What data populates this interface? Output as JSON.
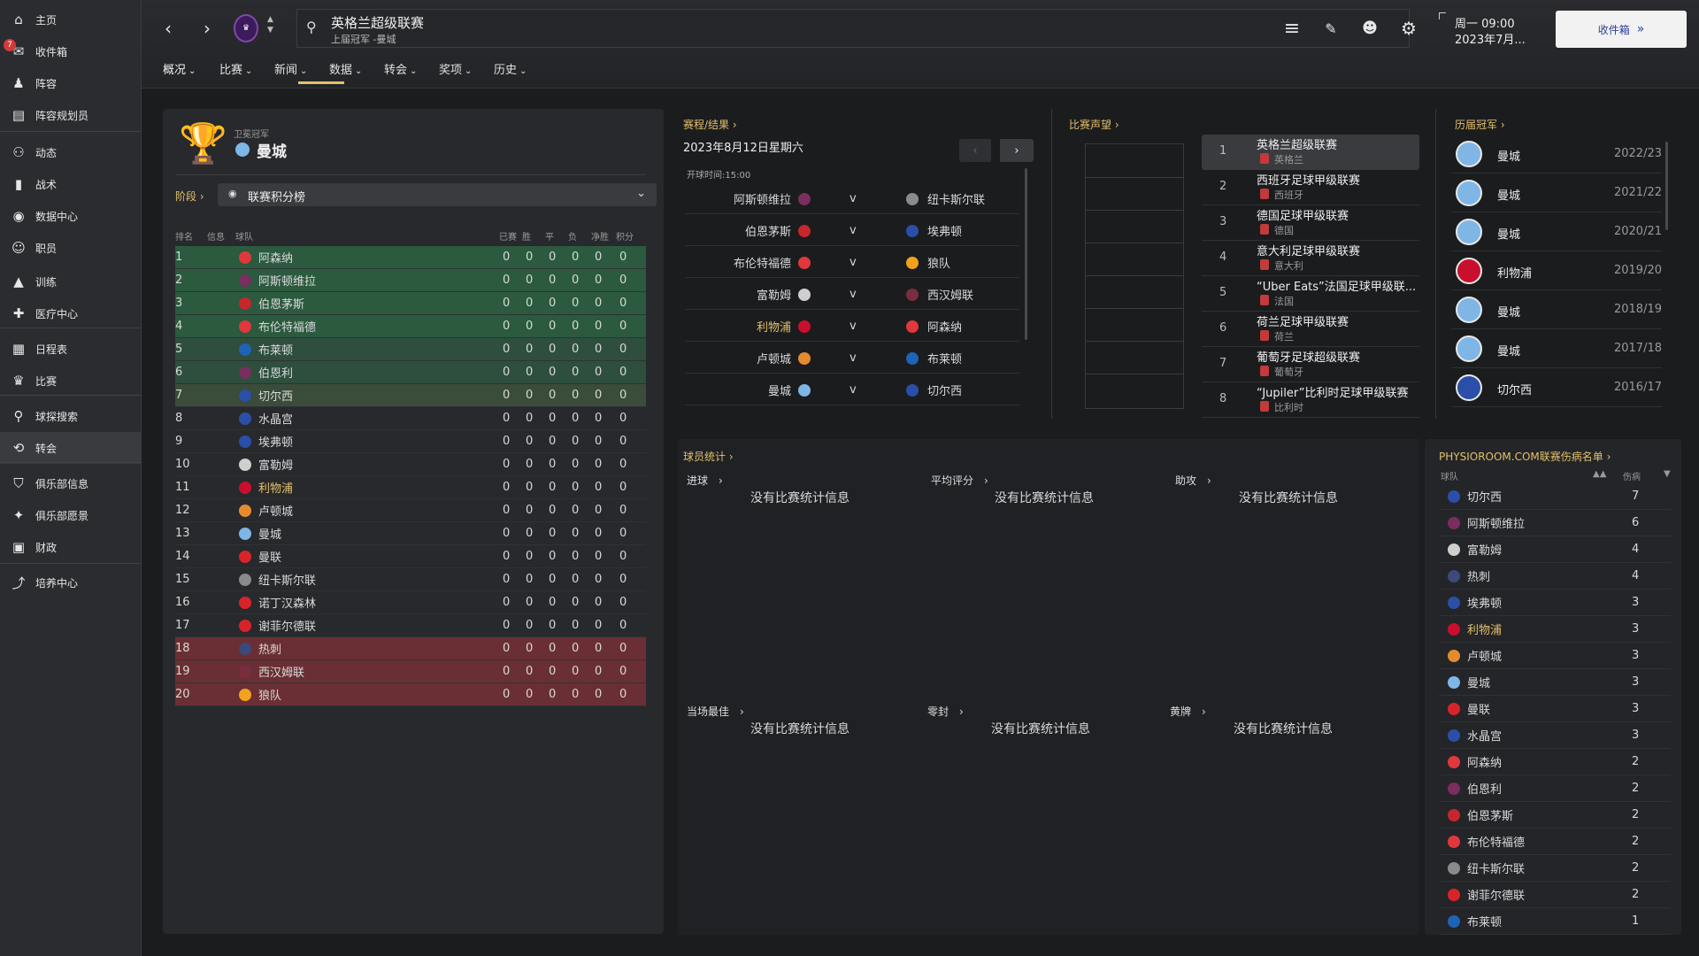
{
  "sidebar": {
    "inbox_badge": "7",
    "items": [
      {
        "label": "主页",
        "icon": "home-icon",
        "glyph": "⌂"
      },
      {
        "label": "收件箱",
        "icon": "inbox-icon",
        "glyph": "✉"
      },
      {
        "label": "阵容",
        "icon": "squad-icon",
        "glyph": "♟"
      },
      {
        "label": "阵容规划员",
        "icon": "planner-icon",
        "glyph": "▤"
      },
      {
        "label": "动态",
        "icon": "dynamics-icon",
        "glyph": "⚇"
      },
      {
        "label": "战术",
        "icon": "tactics-icon",
        "glyph": "▮"
      },
      {
        "label": "数据中心",
        "icon": "data-hub-icon",
        "glyph": "◉"
      },
      {
        "label": "职员",
        "icon": "staff-icon",
        "glyph": "☺"
      },
      {
        "label": "训练",
        "icon": "training-icon",
        "glyph": "▲"
      },
      {
        "label": "医疗中心",
        "icon": "medical-icon",
        "glyph": "✚"
      },
      {
        "label": "日程表",
        "icon": "calendar-icon",
        "glyph": "▦"
      },
      {
        "label": "比赛",
        "icon": "trophy-icon",
        "glyph": "♛"
      },
      {
        "label": "球探搜索",
        "icon": "scouting-icon",
        "glyph": "⚲"
      },
      {
        "label": "转会",
        "icon": "transfers-icon",
        "glyph": "⟲"
      },
      {
        "label": "俱乐部信息",
        "icon": "club-info-icon",
        "glyph": "⛉"
      },
      {
        "label": "俱乐部愿景",
        "icon": "club-vision-icon",
        "glyph": "✦"
      },
      {
        "label": "财政",
        "icon": "finances-icon",
        "glyph": "▣"
      },
      {
        "label": "培养中心",
        "icon": "development-icon",
        "glyph": "⤴"
      }
    ]
  },
  "header": {
    "title": "英格兰超级联赛",
    "subtitle": "上届冠军 -曼城",
    "datetime_line1": "周一 09:00",
    "datetime_line2": "2023年7月...",
    "inbox_button": "收件箱",
    "tabs": [
      "概况",
      "比赛",
      "新闻",
      "数据",
      "转会",
      "奖项",
      "历史"
    ]
  },
  "standings": {
    "champion_caption": "卫冕冠军",
    "champion_name": "曼城",
    "stage_label": "阶段",
    "dropdown_value": "联赛积分榜",
    "columns": [
      "排名",
      "信息",
      "球队",
      "已赛",
      "胜",
      "平",
      "负",
      "净胜",
      "积分"
    ],
    "rows": [
      {
        "pos": "1",
        "team": "阿森纳",
        "color": "#e0383b"
      },
      {
        "pos": "2",
        "team": "阿斯顿维拉",
        "color": "#7a2d5f"
      },
      {
        "pos": "3",
        "team": "伯恩茅斯",
        "color": "#c6262d"
      },
      {
        "pos": "4",
        "team": "布伦特福德",
        "color": "#e0383b"
      },
      {
        "pos": "5",
        "team": "布莱顿",
        "color": "#1e63b5"
      },
      {
        "pos": "6",
        "team": "伯恩利",
        "color": "#7a2d5f"
      },
      {
        "pos": "7",
        "team": "切尔西",
        "color": "#2b4fa8"
      },
      {
        "pos": "8",
        "team": "水晶宫",
        "color": "#2b4fa8"
      },
      {
        "pos": "9",
        "team": "埃弗顿",
        "color": "#2b4fa8"
      },
      {
        "pos": "10",
        "team": "富勒姆",
        "color": "#cfcfcf"
      },
      {
        "pos": "11",
        "team": "利物浦",
        "color": "#c8102e"
      },
      {
        "pos": "12",
        "team": "卢顿城",
        "color": "#e48b2f"
      },
      {
        "pos": "13",
        "team": "曼城",
        "color": "#7fb6e6"
      },
      {
        "pos": "14",
        "team": "曼联",
        "color": "#d9232a"
      },
      {
        "pos": "15",
        "team": "纽卡斯尔联",
        "color": "#8a8a8a"
      },
      {
        "pos": "16",
        "team": "诺丁汉森林",
        "color": "#d9232a"
      },
      {
        "pos": "17",
        "team": "谢菲尔德联",
        "color": "#d9232a"
      },
      {
        "pos": "18",
        "team": "热刺",
        "color": "#3b4a7a"
      },
      {
        "pos": "19",
        "team": "西汉姆联",
        "color": "#7a2d3f"
      },
      {
        "pos": "20",
        "team": "狼队",
        "color": "#f2a31b"
      }
    ],
    "stat_value": "0",
    "zone_colors": {
      "champions": "#2b5a3f",
      "europa": "#2e4f3e",
      "conference": "#3a4c3a",
      "relegation": "#6a2f34"
    }
  },
  "fixtures": {
    "label": "赛程/结果",
    "date": "2023年8月12日星期六",
    "kickoff": "开球时间:15:00",
    "vs": "v",
    "matches": [
      {
        "home": "阿斯顿维拉",
        "hc": "#7a2d5f",
        "away": "纽卡斯尔联",
        "ac": "#8a8a8a"
      },
      {
        "home": "伯恩茅斯",
        "hc": "#c6262d",
        "away": "埃弗顿",
        "ac": "#2b4fa8"
      },
      {
        "home": "布伦特福德",
        "hc": "#e0383b",
        "away": "狼队",
        "ac": "#f2a31b"
      },
      {
        "home": "富勒姆",
        "hc": "#cfcfcf",
        "away": "西汉姆联",
        "ac": "#7a2d3f"
      },
      {
        "home": "利物浦",
        "hc": "#c8102e",
        "away": "阿森纳",
        "ac": "#e0383b"
      },
      {
        "home": "卢顿城",
        "hc": "#e48b2f",
        "away": "布莱顿",
        "ac": "#1e63b5"
      },
      {
        "home": "曼城",
        "hc": "#7fb6e6",
        "away": "切尔西",
        "ac": "#2b4fa8"
      }
    ]
  },
  "reputation": {
    "label": "比赛声望",
    "leagues": [
      {
        "rank": "1",
        "name": "英格兰超级联赛",
        "country": "英格兰"
      },
      {
        "rank": "2",
        "name": "西班牙足球甲级联赛",
        "country": "西班牙"
      },
      {
        "rank": "3",
        "name": "德国足球甲级联赛",
        "country": "德国"
      },
      {
        "rank": "4",
        "name": "意大利足球甲级联赛",
        "country": "意大利"
      },
      {
        "rank": "5",
        "name": "“Uber Eats”法国足球甲级联...",
        "country": "法国"
      },
      {
        "rank": "6",
        "name": "荷兰足球甲级联赛",
        "country": "荷兰"
      },
      {
        "rank": "7",
        "name": "葡萄牙足球超级联赛",
        "country": "葡萄牙"
      },
      {
        "rank": "8",
        "name": "“Jupiler”比利时足球甲级联赛",
        "country": "比利时"
      }
    ]
  },
  "past_winners": {
    "label": "历届冠军",
    "rows": [
      {
        "team": "曼城",
        "season": "2022/23",
        "color": "#7fb6e6"
      },
      {
        "team": "曼城",
        "season": "2021/22",
        "color": "#7fb6e6"
      },
      {
        "team": "曼城",
        "season": "2020/21",
        "color": "#7fb6e6"
      },
      {
        "team": "利物浦",
        "season": "2019/20",
        "color": "#c8102e"
      },
      {
        "team": "曼城",
        "season": "2018/19",
        "color": "#7fb6e6"
      },
      {
        "team": "曼城",
        "season": "2017/18",
        "color": "#7fb6e6"
      },
      {
        "team": "切尔西",
        "season": "2016/17",
        "color": "#2b4fa8"
      }
    ]
  },
  "player_stats": {
    "label": "球员统计",
    "no_data": "没有比赛统计信息",
    "cells": [
      "进球",
      "平均评分",
      "助攻",
      "当场最佳",
      "零封",
      "黄牌"
    ]
  },
  "injuries": {
    "label": "PHYSIOROOM.COM联赛伤病名单",
    "col_team": "球队",
    "col_injuries": "伤病",
    "rows": [
      {
        "team": "切尔西",
        "count": "7",
        "color": "#2b4fa8"
      },
      {
        "team": "阿斯顿维拉",
        "count": "6",
        "color": "#7a2d5f"
      },
      {
        "team": "富勒姆",
        "count": "4",
        "color": "#cfcfcf"
      },
      {
        "team": "热刺",
        "count": "4",
        "color": "#3b4a7a"
      },
      {
        "team": "埃弗顿",
        "count": "3",
        "color": "#2b4fa8"
      },
      {
        "team": "利物浦",
        "count": "3",
        "color": "#c8102e"
      },
      {
        "team": "卢顿城",
        "count": "3",
        "color": "#e48b2f"
      },
      {
        "team": "曼城",
        "count": "3",
        "color": "#7fb6e6"
      },
      {
        "team": "曼联",
        "count": "3",
        "color": "#d9232a"
      },
      {
        "team": "水晶宫",
        "count": "3",
        "color": "#2b4fa8"
      },
      {
        "team": "阿森纳",
        "count": "2",
        "color": "#e0383b"
      },
      {
        "team": "伯恩利",
        "count": "2",
        "color": "#7a2d5f"
      },
      {
        "team": "伯恩茅斯",
        "count": "2",
        "color": "#c6262d"
      },
      {
        "team": "布伦特福德",
        "count": "2",
        "color": "#e0383b"
      },
      {
        "team": "纽卡斯尔联",
        "count": "2",
        "color": "#8a8a8a"
      },
      {
        "team": "谢菲尔德联",
        "count": "2",
        "color": "#d9232a"
      },
      {
        "team": "布莱顿",
        "count": "1",
        "color": "#1e63b5"
      }
    ]
  },
  "colors": {
    "accent": "#e3c06b",
    "liverpool_highlight": "#e3c06b"
  }
}
